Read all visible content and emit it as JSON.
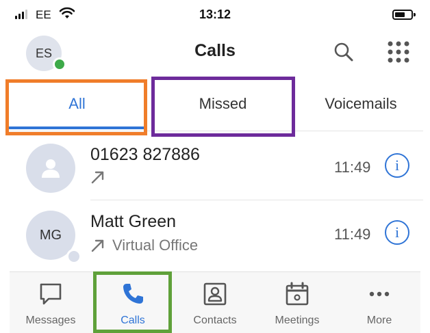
{
  "status_bar": {
    "carrier": "EE",
    "time": "13:12"
  },
  "header": {
    "avatar_initials": "ES",
    "title": "Calls"
  },
  "tabs": [
    {
      "label": "All",
      "selected": true
    },
    {
      "label": "Missed",
      "selected": false
    },
    {
      "label": "Voicemails",
      "selected": false
    }
  ],
  "calls": [
    {
      "name": "01623 827886",
      "subtitle": "",
      "time": "11:49",
      "avatar_initials": ""
    },
    {
      "name": "Matt Green",
      "subtitle": "Virtual Office",
      "time": "11:49",
      "avatar_initials": "MG"
    }
  ],
  "bottom_nav": [
    {
      "label": "Messages",
      "icon": "message-icon"
    },
    {
      "label": "Calls",
      "icon": "phone-icon",
      "selected": true
    },
    {
      "label": "Contacts",
      "icon": "contacts-icon"
    },
    {
      "label": "Meetings",
      "icon": "calendar-icon"
    },
    {
      "label": "More",
      "icon": "more-icon"
    }
  ],
  "colors": {
    "accent": "#2f74d6",
    "presence": "#3daa49",
    "highlight_all": "#f07d2a",
    "highlight_missed": "#6d2b9b",
    "highlight_calls": "#5fa13a"
  }
}
